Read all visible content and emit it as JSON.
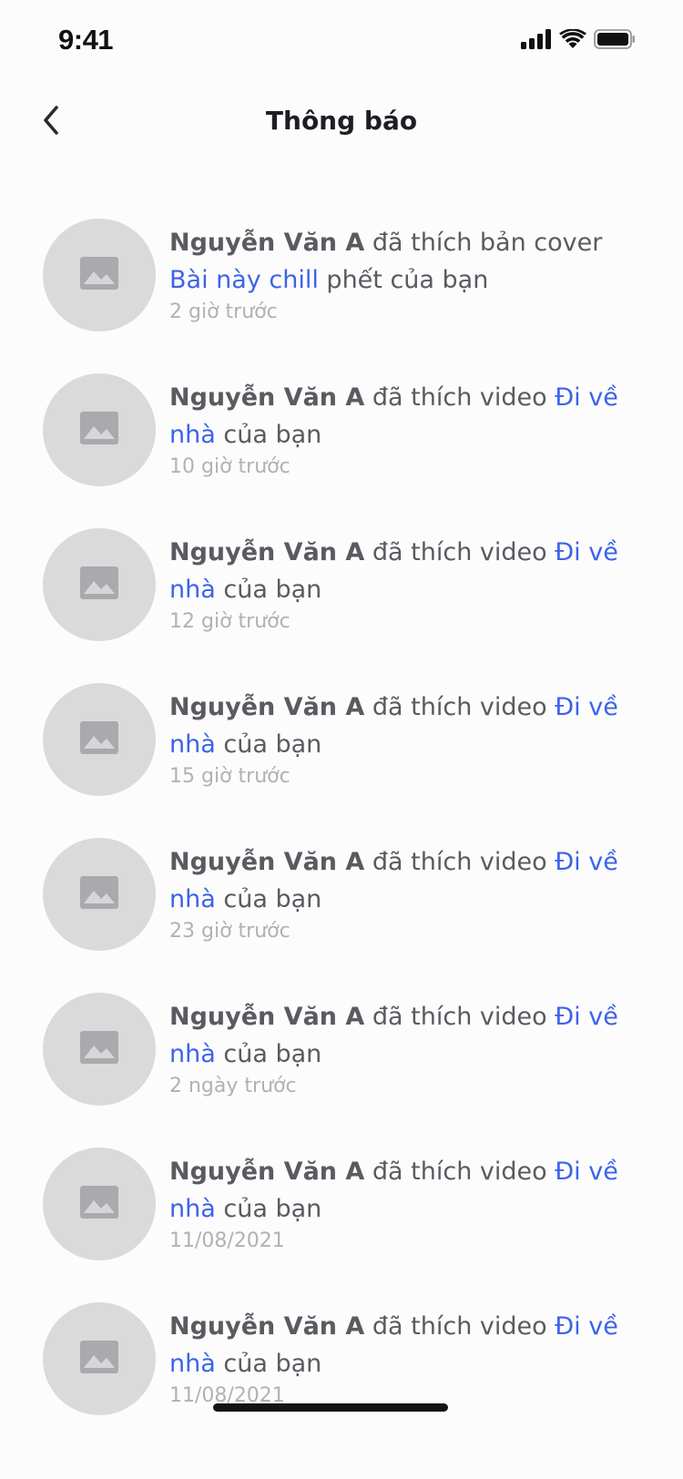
{
  "status_bar": {
    "time": "9:41",
    "icons": [
      "cellular-signal-icon",
      "wifi-icon",
      "battery-icon"
    ]
  },
  "header": {
    "title": "Thông báo",
    "back_icon": "chevron-left-icon"
  },
  "colors": {
    "link": "#3d63e8",
    "text": "#5a5a60",
    "time": "#b1b1b6",
    "avatar": "#dadadb"
  },
  "notifications": [
    {
      "user": "Nguyễn Văn A",
      "action": " đã thích bản cover ",
      "target": "Bài này chill",
      "suffix": " phết của bạn",
      "time": "2 giờ trước"
    },
    {
      "user": "Nguyễn Văn A",
      "action": " đã thích video ",
      "target": "Đi về nhà",
      "suffix": " của bạn",
      "time": "10 giờ trước"
    },
    {
      "user": "Nguyễn Văn A",
      "action": " đã thích video ",
      "target": "Đi về nhà",
      "suffix": " của bạn",
      "time": "12 giờ trước"
    },
    {
      "user": "Nguyễn Văn A",
      "action": " đã thích video ",
      "target": "Đi về nhà",
      "suffix": " của bạn",
      "time": "15 giờ trước"
    },
    {
      "user": "Nguyễn Văn A",
      "action": " đã thích video ",
      "target": "Đi về nhà",
      "suffix": " của bạn",
      "time": "23 giờ trước"
    },
    {
      "user": "Nguyễn Văn A",
      "action": " đã thích video ",
      "target": "Đi về nhà",
      "suffix": " của bạn",
      "time": "2 ngày trước"
    },
    {
      "user": "Nguyễn Văn A",
      "action": " đã thích video ",
      "target": "Đi về nhà",
      "suffix": " của bạn",
      "time": "11/08/2021"
    },
    {
      "user": "Nguyễn Văn A",
      "action": " đã thích video ",
      "target": "Đi về nhà",
      "suffix": " của bạn",
      "time": "11/08/2021"
    }
  ]
}
